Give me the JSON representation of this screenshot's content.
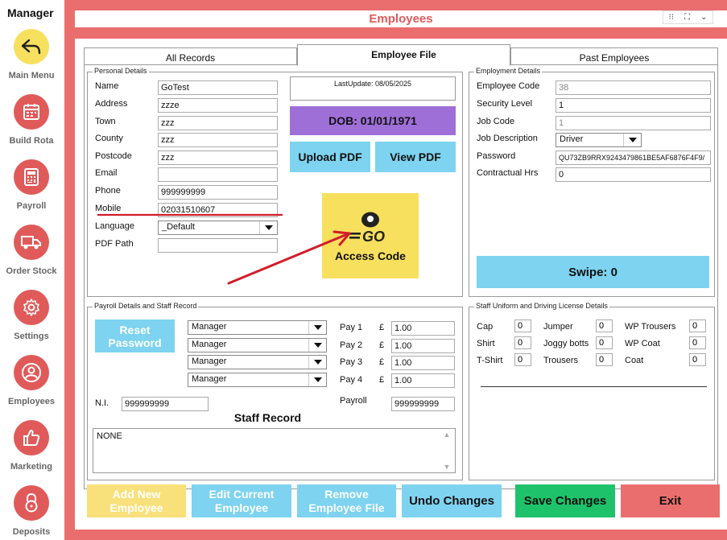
{
  "sidebar": {
    "title": "Manager",
    "items": [
      {
        "label": "Main Menu",
        "icon": "back-arrow-icon",
        "color": "#f6e05e"
      },
      {
        "label": "Build Rota",
        "icon": "calendar-icon",
        "color": "#e05a5a"
      },
      {
        "label": "Payroll",
        "icon": "calculator-icon",
        "color": "#e05a5a"
      },
      {
        "label": "Order Stock",
        "icon": "truck-icon",
        "color": "#e05a5a"
      },
      {
        "label": "Settings",
        "icon": "gear-icon",
        "color": "#e05a5a"
      },
      {
        "label": "Employees",
        "icon": "people-icon",
        "color": "#e05a5a"
      },
      {
        "label": "Marketing",
        "icon": "thumbs-up-icon",
        "color": "#e05a5a"
      },
      {
        "label": "Deposits",
        "icon": "lock-icon",
        "color": "#e05a5a"
      }
    ]
  },
  "header": {
    "title": "Employees"
  },
  "tabs": [
    {
      "label": "All Records",
      "active": false
    },
    {
      "label": "Employee File",
      "active": true
    },
    {
      "label": "Past Employees",
      "active": false
    }
  ],
  "personal": {
    "group_label": "Personal Details",
    "fields": [
      {
        "label": "Name",
        "value": "GoTest"
      },
      {
        "label": "Address",
        "value": "zzze"
      },
      {
        "label": "Town",
        "value": "zzz"
      },
      {
        "label": "County",
        "value": "zzz"
      },
      {
        "label": "Postcode",
        "value": "zzz"
      },
      {
        "label": "Email",
        "value": ""
      },
      {
        "label": "Phone",
        "value": "999999999"
      },
      {
        "label": "Mobile",
        "value": "02031510607"
      }
    ],
    "language_label": "Language",
    "language_value": "_Default",
    "pdf_path_label": "PDF Path",
    "pdf_path_value": ""
  },
  "middle": {
    "last_update": "LastUpdate: 08/05/2025",
    "dob": "DOB: 01/01/1971",
    "upload_pdf": "Upload PDF",
    "view_pdf": "View PDF",
    "access_logo": "GO",
    "access_code": "Access Code"
  },
  "employment": {
    "group_label": "Employment Details",
    "employee_code_label": "Employee Code",
    "employee_code": "38",
    "security_level_label": "Security Level",
    "security_level": "1",
    "job_code_label": "Job Code",
    "job_code": "1",
    "job_description_label": "Job Description",
    "job_description": "Driver",
    "password_label": "Password",
    "password": "QU73ZB9RRX9243479861BE5AF6876F4F9/",
    "contractual_hrs_label": "Contractual Hrs",
    "contractual_hrs": "0",
    "swipe": "Swipe: 0"
  },
  "payroll": {
    "group_label": "Payroll Details and Staff Record",
    "reset_password": "Reset Password",
    "roles": [
      "Manager",
      "Manager",
      "Manager",
      "Manager"
    ],
    "pays": [
      {
        "label": "Pay 1",
        "currency": "£",
        "value": "1.00"
      },
      {
        "label": "Pay 2",
        "currency": "£",
        "value": "1.00"
      },
      {
        "label": "Pay 3",
        "currency": "£",
        "value": "1.00"
      },
      {
        "label": "Pay 4",
        "currency": "£",
        "value": "1.00"
      }
    ],
    "ni_label": "N.I.",
    "ni_value": "999999999",
    "payroll_label": "Payroll",
    "payroll_value": "999999999",
    "staff_record_title": "Staff Record",
    "staff_record_text": "NONE"
  },
  "uniform": {
    "group_label": "Staff Uniform and Driving License Details",
    "items": [
      {
        "label": "Cap",
        "value": "0"
      },
      {
        "label": "Jumper",
        "value": "0"
      },
      {
        "label": "WP Trousers",
        "value": "0"
      },
      {
        "label": "Shirt",
        "value": "0"
      },
      {
        "label": "Joggy botts",
        "value": "0"
      },
      {
        "label": "WP Coat",
        "value": "0"
      },
      {
        "label": "T-Shirt",
        "value": "0"
      },
      {
        "label": "Trousers",
        "value": "0"
      },
      {
        "label": "Coat",
        "value": "0"
      }
    ]
  },
  "actions": {
    "add_new": "Add New Employee",
    "edit_current": "Edit Current Employee",
    "remove": "Remove Employee File",
    "undo": "Undo Changes",
    "save": "Save Changes",
    "exit": "Exit"
  },
  "colors": {
    "frame": "#ea6e6e",
    "accent_red": "#e05a5a",
    "yellow": "#f6e05e",
    "light_blue": "#7dd3f0",
    "purple": "#9f6fd8",
    "green": "#1ec26a",
    "annotation_red": "#d11d2a"
  }
}
